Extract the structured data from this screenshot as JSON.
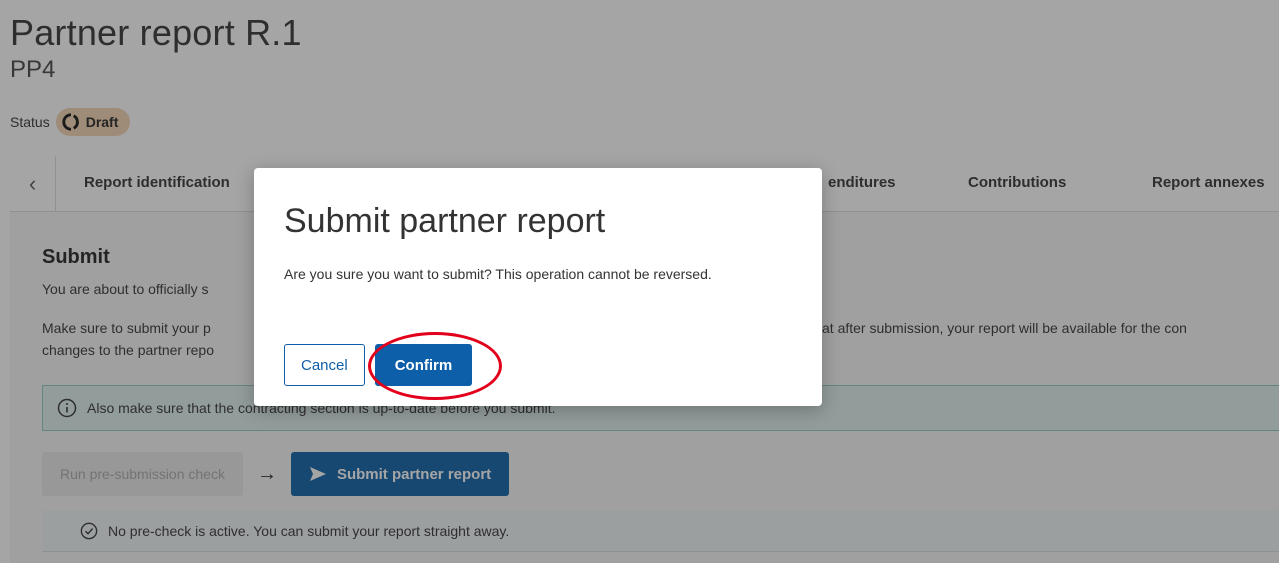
{
  "header": {
    "title": "Partner report R.1",
    "partner": "PP4",
    "status_label": "Status",
    "status_value": "Draft",
    "status_color": "#f3d3b2"
  },
  "tabs": {
    "prev_icon": "chevron-left-icon",
    "items": [
      {
        "label": "Report identification"
      },
      {
        "label": "enditures"
      },
      {
        "label": "Contributions"
      },
      {
        "label": "Report annexes"
      }
    ]
  },
  "submit": {
    "title": "Submit",
    "intro": "You are about to officially s",
    "note_line1_left": "Make sure to submit your p",
    "note_line2_left": "changes to the partner repo",
    "note_line1_right": "at after submission, your report will be available for the con",
    "info_text": "Also make sure that the contracting section is up-to-date before you submit.",
    "precheck_button": "Run pre-submission check",
    "arrow": "→",
    "submit_button": "Submit partner report",
    "precheck_text": "No pre-check is active. You can submit your report straight away."
  },
  "modal": {
    "title": "Submit partner report",
    "text": "Are you sure you want to submit? This operation cannot be reversed.",
    "cancel": "Cancel",
    "confirm": "Confirm",
    "highlight_color": "#e3001b"
  },
  "colors": {
    "primary": "#0c5fa8",
    "info_bg": "#dff0ee",
    "info_border": "#8ec9c1"
  }
}
